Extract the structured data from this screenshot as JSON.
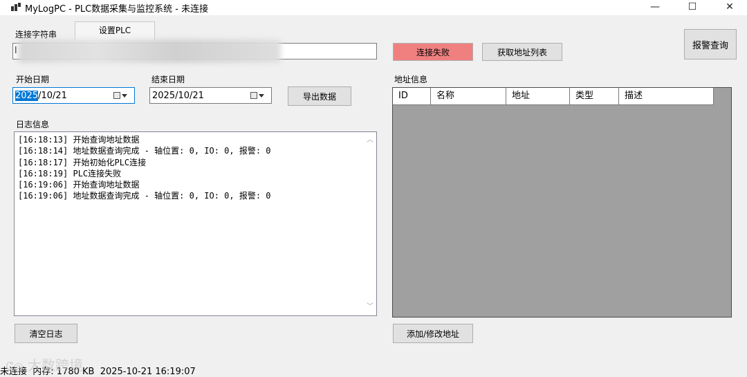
{
  "window": {
    "title": "MyLogPC - PLC数据采集与监控系统 - 未连接",
    "minimize": "—",
    "maximize": "☐",
    "close": "✕"
  },
  "tabs": [
    {
      "label": "连接字符串"
    },
    {
      "label": "设置PLC"
    }
  ],
  "conn": {
    "value": "l",
    "status_label": "连接失败",
    "status_color": "#f08080",
    "get_address_list_label": "获取地址列表"
  },
  "alarm_query_label": "报警查询",
  "dates": {
    "start_label": "开始日期",
    "end_label": "结束日期",
    "start_selected": "2025",
    "start_rest": "/10/21",
    "end_value": "2025/10/21",
    "export_label": "导出数据"
  },
  "log": {
    "label": "日志信息",
    "lines": [
      "[16:18:13] 开始查询地址数据",
      "[16:18:14] 地址数据查询完成 - 轴位置: 0, IO: 0, 报警: 0",
      "[16:18:17] 开始初始化PLC连接",
      "[16:18:19] PLC连接失败",
      "[16:19:06] 开始查询地址数据",
      "[16:19:06] 地址数据查询完成 - 轴位置: 0, IO: 0, 报警: 0"
    ],
    "clear_label": "清空日志"
  },
  "address": {
    "label": "地址信息",
    "columns": [
      "ID",
      "名称",
      "地址",
      "类型",
      "描述"
    ],
    "add_edit_label": "添加/修改地址"
  },
  "status": {
    "text": "未连接  内存: 1780 KB  2025-10-21 16:19:07"
  },
  "watermark": "大数跨境"
}
